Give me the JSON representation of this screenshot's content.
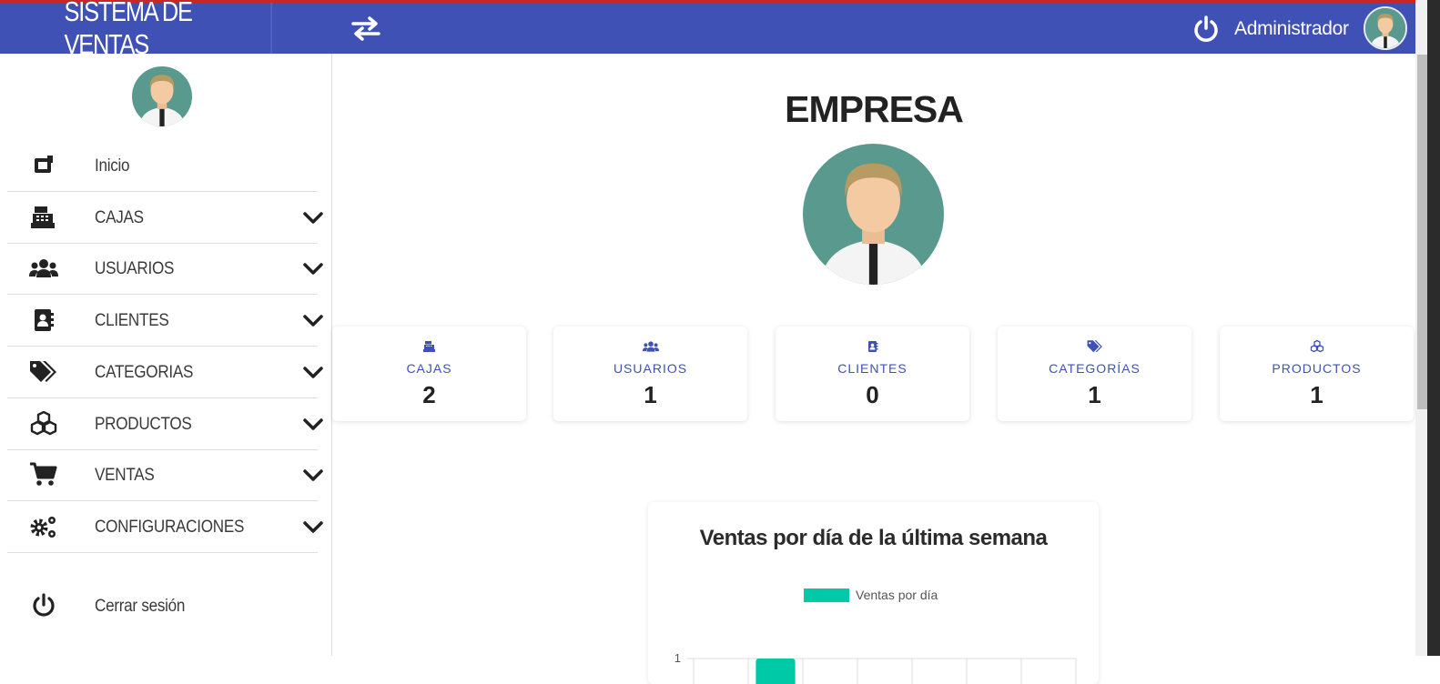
{
  "header": {
    "brand": "SISTEMA DE VENTAS",
    "user_name": "Administrador",
    "icons": {
      "toggle": "swap-arrows-icon",
      "logout": "power-icon",
      "avatar": "user-avatar"
    },
    "color": "#3f51b5"
  },
  "sidebar": {
    "items": [
      {
        "label": "Inicio",
        "icon": "home-square-icon",
        "expandable": false
      },
      {
        "label": "CAJAS",
        "icon": "cash-register-icon",
        "expandable": true
      },
      {
        "label": "USUARIOS",
        "icon": "users-icon",
        "expandable": true
      },
      {
        "label": "CLIENTES",
        "icon": "address-book-icon",
        "expandable": true
      },
      {
        "label": "CATEGORIAS",
        "icon": "tags-icon",
        "expandable": true
      },
      {
        "label": "PRODUCTOS",
        "icon": "cubes-icon",
        "expandable": true
      },
      {
        "label": "VENTAS",
        "icon": "cart-icon",
        "expandable": true
      },
      {
        "label": "CONFIGURACIONES",
        "icon": "cogs-icon",
        "expandable": true
      }
    ],
    "logout": {
      "label": "Cerrar sesión",
      "icon": "power-icon"
    }
  },
  "main": {
    "company_title": "EMPRESA",
    "stats": [
      {
        "label": "CAJAS",
        "value": "2",
        "icon": "cash-register-icon"
      },
      {
        "label": "USUARIOS",
        "value": "1",
        "icon": "users-icon"
      },
      {
        "label": "CLIENTES",
        "value": "0",
        "icon": "address-book-icon"
      },
      {
        "label": "CATEGORÍAS",
        "value": "1",
        "icon": "tags-icon"
      },
      {
        "label": "PRODUCTOS",
        "value": "1",
        "icon": "cubes-icon"
      }
    ],
    "accent_color": "#3f51b5"
  },
  "chart_data": {
    "type": "bar",
    "title": "Ventas por día de la última semana",
    "series": [
      {
        "name": "Ventas por día",
        "color": "#00c9a7",
        "values": [
          0,
          1,
          0,
          0,
          0,
          0,
          0
        ]
      }
    ],
    "ylim": [
      0,
      1
    ],
    "y_ticks": [
      "1"
    ],
    "legend": "top"
  }
}
